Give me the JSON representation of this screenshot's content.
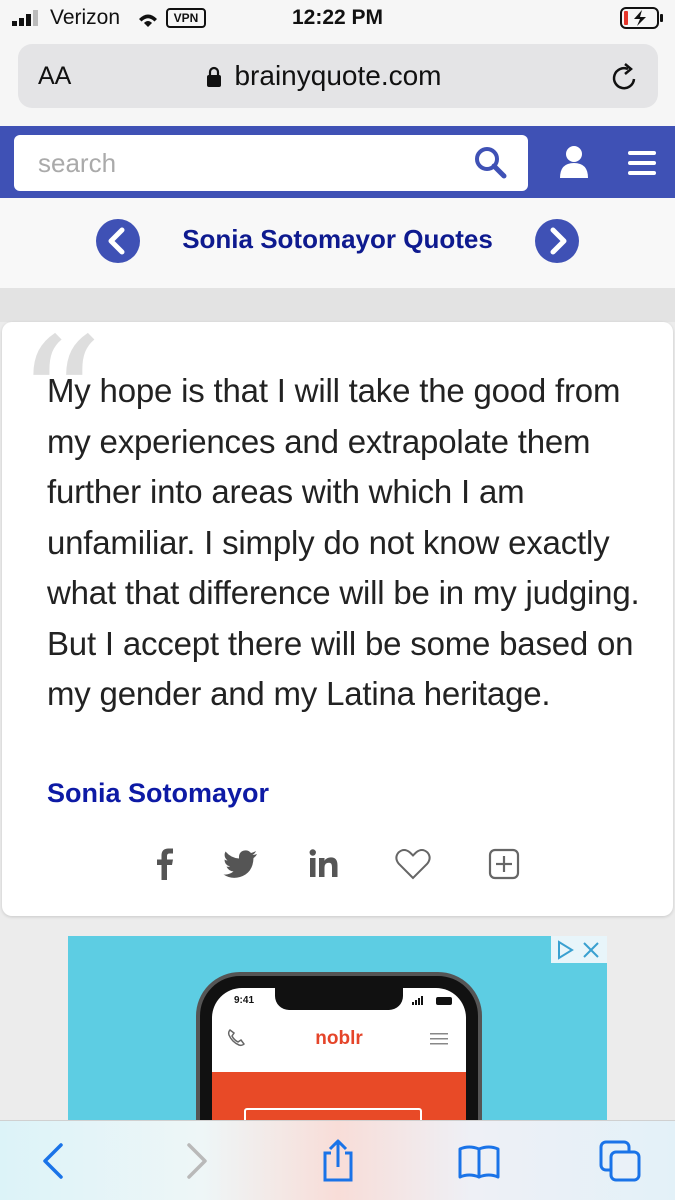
{
  "status_bar": {
    "carrier": "Verizon",
    "vpn": "VPN",
    "time": "12:22 PM"
  },
  "browser": {
    "text_size_label": "AA",
    "domain": "brainyquote.com"
  },
  "header": {
    "search_placeholder": "search",
    "accent_color": "#3f51b5"
  },
  "page": {
    "title": "Sonia Sotomayor Quotes",
    "open_quote_glyph": "“"
  },
  "quote": {
    "text": "My hope is that I will take the good from my experiences and extrapolate them further into areas with which I am unfamiliar. I simply do not know exactly what that difference will be in my judging. But I accept there will be some based on my gender and my Latina heritage.",
    "author": "Sonia Sotomayor",
    "share_icons": [
      "facebook-icon",
      "twitter-icon",
      "linkedin-icon",
      "heart-icon",
      "plus-square-icon"
    ]
  },
  "ad": {
    "phone_time": "9:41",
    "brand": "noblr",
    "background_color": "#5dcde3",
    "brand_color": "#e5452a"
  },
  "toolbar": {
    "icons": [
      "back-icon",
      "forward-icon",
      "share-icon",
      "bookmarks-icon",
      "tabs-icon"
    ]
  }
}
